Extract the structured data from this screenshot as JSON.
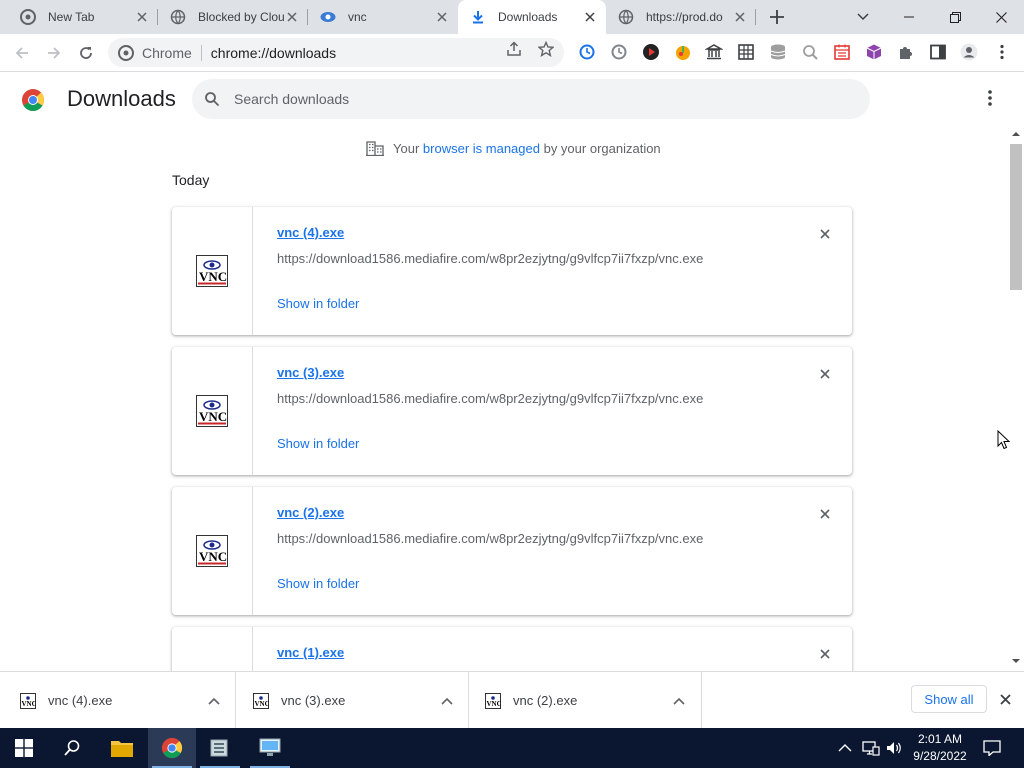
{
  "tabs": [
    {
      "title": "New Tab",
      "icon": "chrome-icon",
      "active": false
    },
    {
      "title": "Blocked by Clou",
      "icon": "globe-icon",
      "active": false
    },
    {
      "title": "vnc",
      "icon": "vnc-icon",
      "active": false
    },
    {
      "title": "Downloads",
      "icon": "download-icon",
      "active": true
    },
    {
      "title": "https://prod.do",
      "icon": "globe-icon",
      "active": false
    }
  ],
  "omnibox": {
    "site_chip": "Chrome",
    "url": "chrome://downloads"
  },
  "page": {
    "title": "Downloads",
    "search_placeholder": "Search downloads",
    "managed_prefix": "Your",
    "managed_link": "browser is managed",
    "managed_suffix": "by your organization",
    "section_label": "Today"
  },
  "downloads": [
    {
      "file": "vnc (4).exe",
      "url": "https://download1586.mediafire.com/w8pr2ezjytng/g9vlfcp7ii7fxzp/vnc.exe",
      "action": "Show in folder"
    },
    {
      "file": "vnc (3).exe",
      "url": "https://download1586.mediafire.com/w8pr2ezjytng/g9vlfcp7ii7fxzp/vnc.exe",
      "action": "Show in folder"
    },
    {
      "file": "vnc (2).exe",
      "url": "https://download1586.mediafire.com/w8pr2ezjytng/g9vlfcp7ii7fxzp/vnc.exe",
      "action": "Show in folder"
    },
    {
      "file": "vnc (1).exe",
      "url": "",
      "action": ""
    }
  ],
  "shelf": {
    "items": [
      "vnc (4).exe",
      "vnc (3).exe",
      "vnc (2).exe"
    ],
    "show_all": "Show all"
  },
  "taskbar": {
    "time": "2:01 AM",
    "date": "9/28/2022"
  },
  "colors": {
    "accent": "#1a73e8",
    "tabstrip": "#dee1e6",
    "taskbar": "#0b1730"
  }
}
